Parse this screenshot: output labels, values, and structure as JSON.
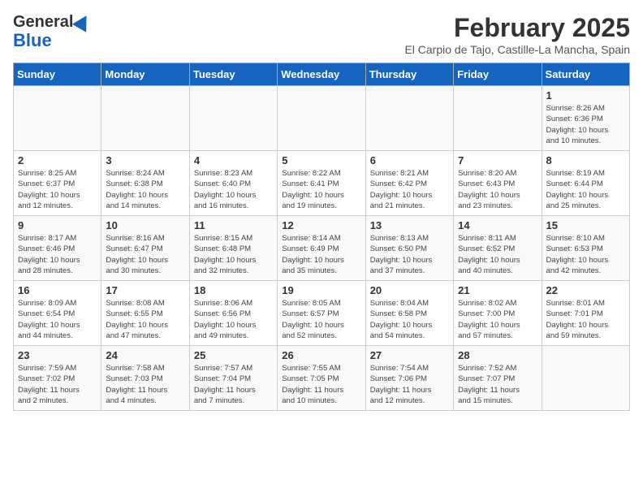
{
  "header": {
    "logo_line1": "General",
    "logo_line2": "Blue",
    "month": "February 2025",
    "location": "El Carpio de Tajo, Castille-La Mancha, Spain"
  },
  "days_of_week": [
    "Sunday",
    "Monday",
    "Tuesday",
    "Wednesday",
    "Thursday",
    "Friday",
    "Saturday"
  ],
  "weeks": [
    [
      {
        "day": "",
        "info": ""
      },
      {
        "day": "",
        "info": ""
      },
      {
        "day": "",
        "info": ""
      },
      {
        "day": "",
        "info": ""
      },
      {
        "day": "",
        "info": ""
      },
      {
        "day": "",
        "info": ""
      },
      {
        "day": "1",
        "info": "Sunrise: 8:26 AM\nSunset: 6:36 PM\nDaylight: 10 hours\nand 10 minutes."
      }
    ],
    [
      {
        "day": "2",
        "info": "Sunrise: 8:25 AM\nSunset: 6:37 PM\nDaylight: 10 hours\nand 12 minutes."
      },
      {
        "day": "3",
        "info": "Sunrise: 8:24 AM\nSunset: 6:38 PM\nDaylight: 10 hours\nand 14 minutes."
      },
      {
        "day": "4",
        "info": "Sunrise: 8:23 AM\nSunset: 6:40 PM\nDaylight: 10 hours\nand 16 minutes."
      },
      {
        "day": "5",
        "info": "Sunrise: 8:22 AM\nSunset: 6:41 PM\nDaylight: 10 hours\nand 19 minutes."
      },
      {
        "day": "6",
        "info": "Sunrise: 8:21 AM\nSunset: 6:42 PM\nDaylight: 10 hours\nand 21 minutes."
      },
      {
        "day": "7",
        "info": "Sunrise: 8:20 AM\nSunset: 6:43 PM\nDaylight: 10 hours\nand 23 minutes."
      },
      {
        "day": "8",
        "info": "Sunrise: 8:19 AM\nSunset: 6:44 PM\nDaylight: 10 hours\nand 25 minutes."
      }
    ],
    [
      {
        "day": "9",
        "info": "Sunrise: 8:17 AM\nSunset: 6:46 PM\nDaylight: 10 hours\nand 28 minutes."
      },
      {
        "day": "10",
        "info": "Sunrise: 8:16 AM\nSunset: 6:47 PM\nDaylight: 10 hours\nand 30 minutes."
      },
      {
        "day": "11",
        "info": "Sunrise: 8:15 AM\nSunset: 6:48 PM\nDaylight: 10 hours\nand 32 minutes."
      },
      {
        "day": "12",
        "info": "Sunrise: 8:14 AM\nSunset: 6:49 PM\nDaylight: 10 hours\nand 35 minutes."
      },
      {
        "day": "13",
        "info": "Sunrise: 8:13 AM\nSunset: 6:50 PM\nDaylight: 10 hours\nand 37 minutes."
      },
      {
        "day": "14",
        "info": "Sunrise: 8:11 AM\nSunset: 6:52 PM\nDaylight: 10 hours\nand 40 minutes."
      },
      {
        "day": "15",
        "info": "Sunrise: 8:10 AM\nSunset: 6:53 PM\nDaylight: 10 hours\nand 42 minutes."
      }
    ],
    [
      {
        "day": "16",
        "info": "Sunrise: 8:09 AM\nSunset: 6:54 PM\nDaylight: 10 hours\nand 44 minutes."
      },
      {
        "day": "17",
        "info": "Sunrise: 8:08 AM\nSunset: 6:55 PM\nDaylight: 10 hours\nand 47 minutes."
      },
      {
        "day": "18",
        "info": "Sunrise: 8:06 AM\nSunset: 6:56 PM\nDaylight: 10 hours\nand 49 minutes."
      },
      {
        "day": "19",
        "info": "Sunrise: 8:05 AM\nSunset: 6:57 PM\nDaylight: 10 hours\nand 52 minutes."
      },
      {
        "day": "20",
        "info": "Sunrise: 8:04 AM\nSunset: 6:58 PM\nDaylight: 10 hours\nand 54 minutes."
      },
      {
        "day": "21",
        "info": "Sunrise: 8:02 AM\nSunset: 7:00 PM\nDaylight: 10 hours\nand 57 minutes."
      },
      {
        "day": "22",
        "info": "Sunrise: 8:01 AM\nSunset: 7:01 PM\nDaylight: 10 hours\nand 59 minutes."
      }
    ],
    [
      {
        "day": "23",
        "info": "Sunrise: 7:59 AM\nSunset: 7:02 PM\nDaylight: 11 hours\nand 2 minutes."
      },
      {
        "day": "24",
        "info": "Sunrise: 7:58 AM\nSunset: 7:03 PM\nDaylight: 11 hours\nand 4 minutes."
      },
      {
        "day": "25",
        "info": "Sunrise: 7:57 AM\nSunset: 7:04 PM\nDaylight: 11 hours\nand 7 minutes."
      },
      {
        "day": "26",
        "info": "Sunrise: 7:55 AM\nSunset: 7:05 PM\nDaylight: 11 hours\nand 10 minutes."
      },
      {
        "day": "27",
        "info": "Sunrise: 7:54 AM\nSunset: 7:06 PM\nDaylight: 11 hours\nand 12 minutes."
      },
      {
        "day": "28",
        "info": "Sunrise: 7:52 AM\nSunset: 7:07 PM\nDaylight: 11 hours\nand 15 minutes."
      },
      {
        "day": "",
        "info": ""
      }
    ]
  ]
}
